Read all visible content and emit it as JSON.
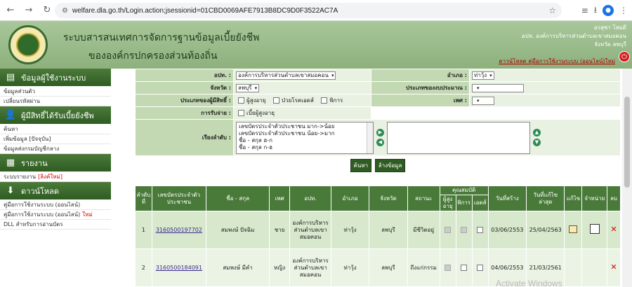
{
  "browser": {
    "url": "welfare.dla.go.th/Login.action;jsessionid=01CBD0069AFE7913B8DC9D0F3522AC7A"
  },
  "header": {
    "title_line1": "ระบบสารสนเทศการจัดการฐานข้อมูลเบี้ยยังชีพ",
    "title_line2": "ขององค์กรปกครองส่วนท้องถิ่น",
    "user_name": "อรสุชา โสมดี",
    "user_org": "อปท. องค์การบริหารส่วนตำบลเขาสมอคอน",
    "user_province": "จังหวัด ลพบุรี",
    "manual_links": "ดาวน์โหลด คู่มือการใช้งานระบบ (ออนไลน์)ใหม่"
  },
  "sidebar": {
    "sections": [
      {
        "title": "ข้อมูลผู้ใช้งานระบบ",
        "items": [
          {
            "label": "ข้อมูลส่วนตัว",
            "new": ""
          },
          {
            "label": "เปลี่ยนรหัสผ่าน",
            "new": ""
          }
        ]
      },
      {
        "title": "ผู้มีสิทธิ์ได้รับเบี้ยยังชีพ",
        "items": [
          {
            "label": "ค้นหา",
            "new": ""
          },
          {
            "label": "เพิ่มข้อมูล [ปัจจุบัน]",
            "new": ""
          },
          {
            "label": "ข้อมูลส่งกรมบัญชีกลาง",
            "new": ""
          }
        ]
      },
      {
        "title": "รายงาน",
        "items": [
          {
            "label": "ระบบรายงาน",
            "new": "[ลิงค์ใหม่]"
          }
        ]
      },
      {
        "title": "ดาวน์โหลด",
        "items": [
          {
            "label": "คู่มือการใช้งานระบบ (ออนไลน์)",
            "new": ""
          },
          {
            "label": "คู่มือการใช้งานระบบ (ออนไลน์)",
            "new": "ใหม่"
          },
          {
            "label": "DLL สำหรับการอ่านบัตร",
            "new": ""
          }
        ]
      }
    ]
  },
  "filter": {
    "org_label": "อปท. :",
    "org_value": "องค์การบริหารส่วนตำบลเขาสมอคอน",
    "district_label": "อำเภอ :",
    "district_value": "ท่าวุ้ง",
    "province_label": "จังหวัด :",
    "province_value": "ลพบุรี",
    "budget_label": "ประเภทของงบประมาณ :",
    "type_label": "ประเภทของผู้มีสิทธิ์ :",
    "type_elderly": "ผู้สูงอายุ",
    "type_aids": "ป่วยโรคเอดส์",
    "type_disabled": "พิการ",
    "gender_label": "เพศ :",
    "receive_label": "การรับจ่าย :",
    "receive_option": "เบี้ยผู้สูงอายุ",
    "sort_label": "เรียงลำดับ :",
    "sort_options": [
      "เลขบัตรประจำตัวประชาชน มาก->น้อย",
      "เลขบัตรประจำตัวประชาชน น้อย->มาก",
      "ชื่อ - สกุล ฮ-ก",
      "ชื่อ - สกุล ก-ฮ"
    ],
    "search_button": "ค้นหา",
    "clear_button": "ล้างข้อมูล"
  },
  "table": {
    "headers": {
      "seq": "ลำดับที่",
      "id": "เลขบัตรประจำตัวประชาชน",
      "name": "ชื่อ - สกุล",
      "gender": "เพศ",
      "org": "อปท.",
      "district": "อำเภอ",
      "province": "จังหวัด",
      "status": "สถานะ",
      "qual": "คุณสมบัติ",
      "elderly": "ผู้สูงอายุ",
      "disabled": "พิการ",
      "aids": "เอดส์",
      "created": "วันที่สร้าง",
      "modified": "วันที่แก้ไขล่าสุด",
      "edit": "แก้ไข",
      "distribute": "จำหน่าย",
      "delete": "ลบ"
    },
    "rows": [
      {
        "seq": "1",
        "id": "3160500197702",
        "name": "สมพงษ์ ปัจฉิม",
        "gender": "ชาย",
        "org": "องค์การบริหารส่วนตำบลเขาสมอคอน",
        "district": "ท่าวุ้ง",
        "province": "ลพบุรี",
        "status": "มีชีวิตอยู่",
        "created": "03/06/2553",
        "modified": "25/04/2563"
      },
      {
        "seq": "2",
        "id": "3160500184091",
        "name": "สมพงษ์ มีคำ",
        "gender": "หญิง",
        "org": "องค์การบริหารส่วนตำบลเขาสมอคอน",
        "district": "ท่าวุ้ง",
        "province": "ลพบุรี",
        "status": "ถึงแก่กรรม",
        "created": "04/06/2553",
        "modified": "21/03/2561"
      }
    ]
  },
  "watermark": "Activate Windows"
}
